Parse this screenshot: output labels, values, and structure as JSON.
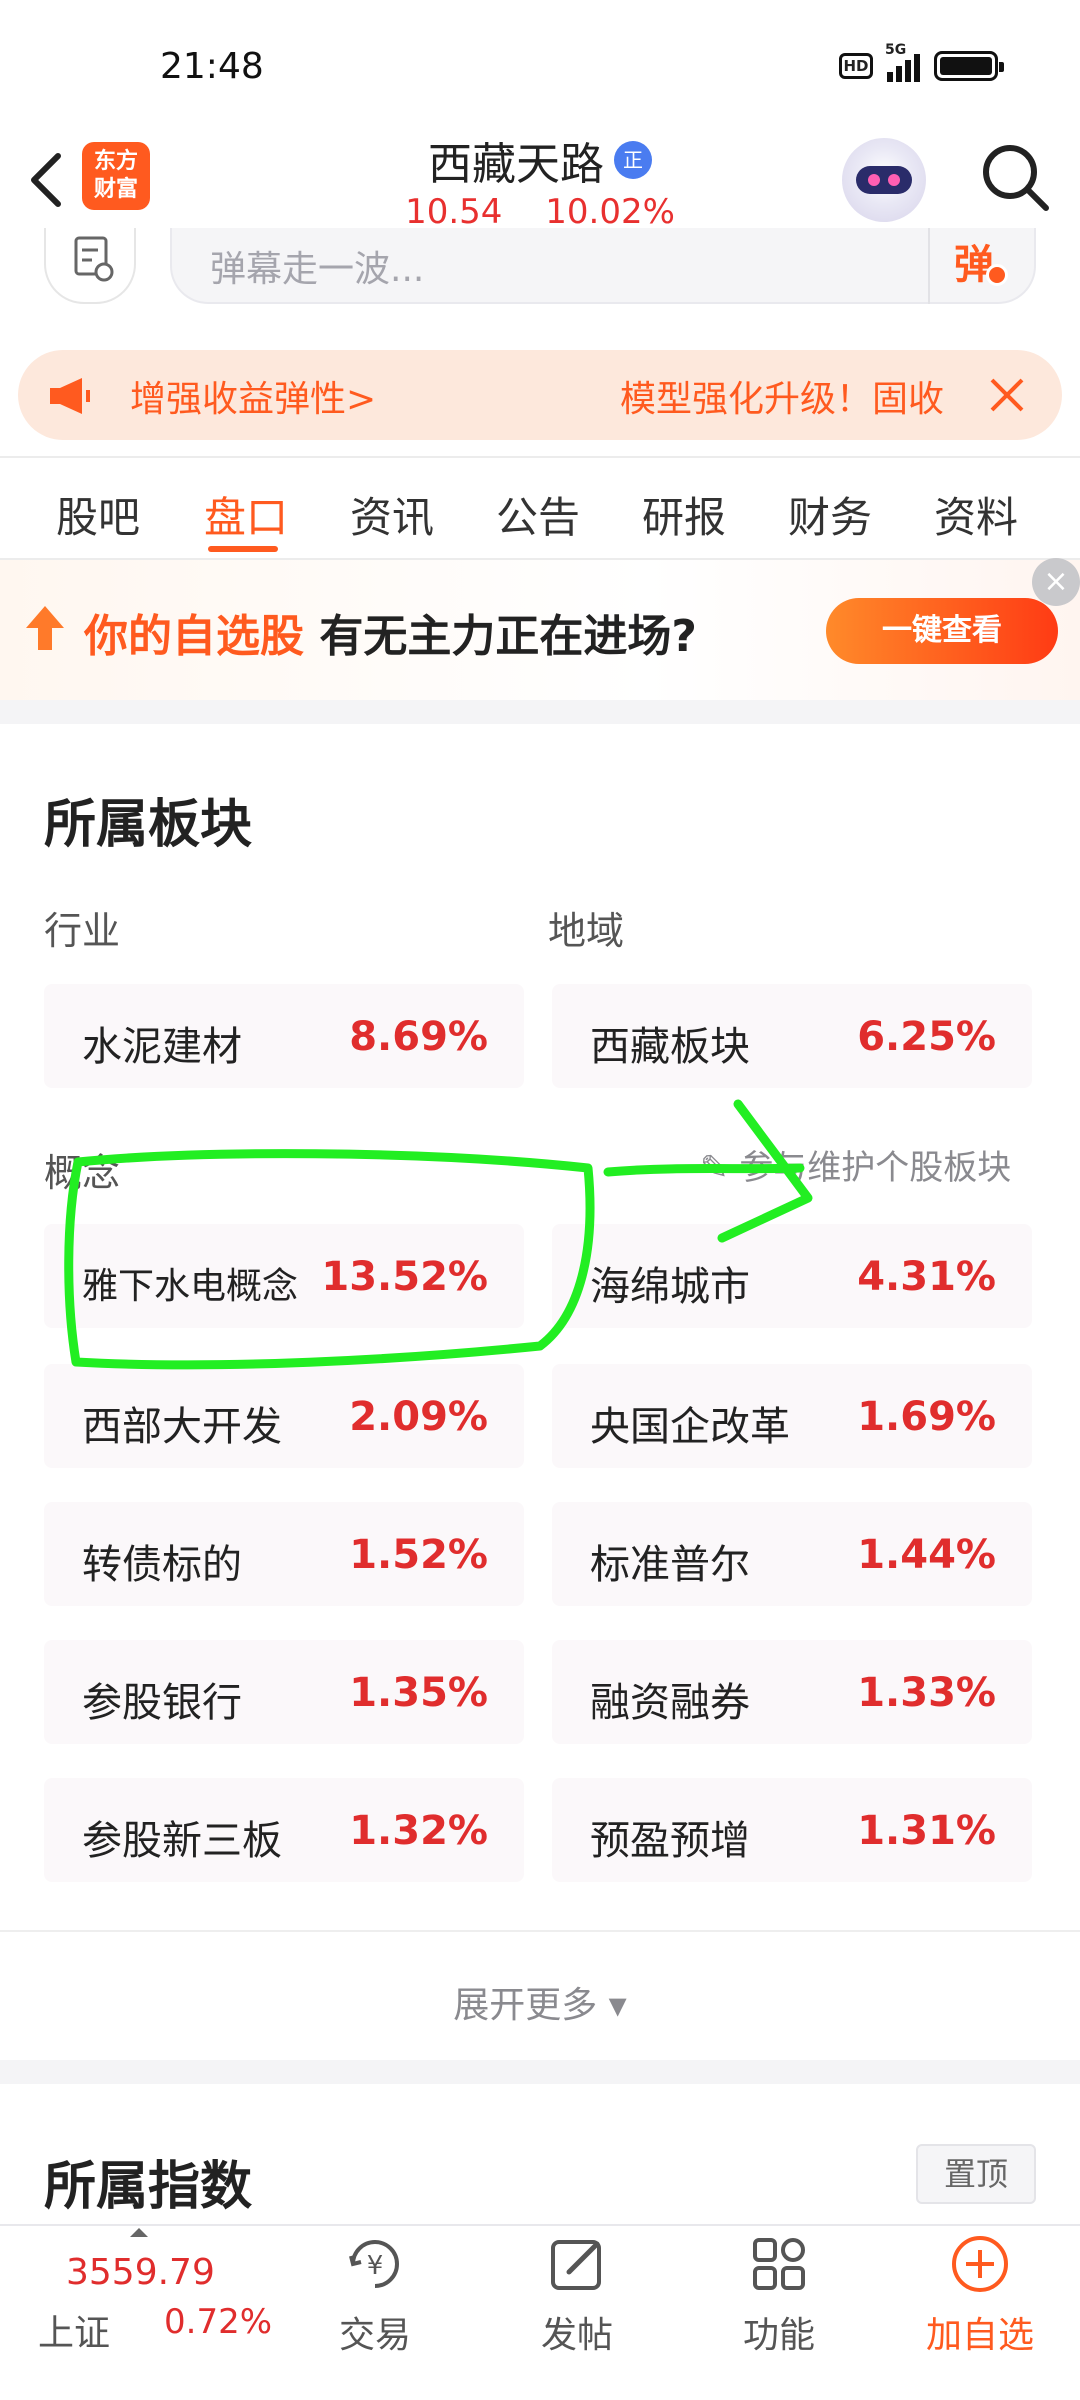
{
  "status_bar": {
    "time": "21:48",
    "network": "5G",
    "hd": "HD"
  },
  "header": {
    "logo_text_top": "东方",
    "logo_text_bottom": "财富",
    "stock_name": "西藏天路",
    "rz_badge": "正",
    "price": "10.54",
    "change_pct": "10.02%"
  },
  "danmaku": {
    "placeholder": "弹幕走一波...",
    "button_label": "弹"
  },
  "notice": {
    "left_text": "增强收益弹性>",
    "right_text": "模型强化升级！固收",
    "close_icon": "close-icon"
  },
  "tabs": [
    {
      "label": "股吧",
      "active": false
    },
    {
      "label": "盘口",
      "active": true
    },
    {
      "label": "资讯",
      "active": false
    },
    {
      "label": "公告",
      "active": false
    },
    {
      "label": "研报",
      "active": false
    },
    {
      "label": "财务",
      "active": false
    },
    {
      "label": "资料",
      "active": false
    }
  ],
  "promo": {
    "highlight": "你的自选股",
    "text": "有无主力正在进场?",
    "button_label": "一键查看"
  },
  "sectors": {
    "title": "所属板块",
    "industry_label": "行业",
    "region_label": "地域",
    "concept_label": "概念",
    "maintain_label": "参与维护个股板块",
    "industry": {
      "name": "水泥建材",
      "pct": "8.69%"
    },
    "region": {
      "name": "西藏板块",
      "pct": "6.25%"
    },
    "concepts": [
      {
        "name": "雅下水电概念",
        "pct": "13.52%"
      },
      {
        "name": "海绵城市",
        "pct": "4.31%"
      },
      {
        "name": "西部大开发",
        "pct": "2.09%"
      },
      {
        "name": "央国企改革",
        "pct": "1.69%"
      },
      {
        "name": "转债标的",
        "pct": "1.52%"
      },
      {
        "name": "标准普尔",
        "pct": "1.44%"
      },
      {
        "name": "参股银行",
        "pct": "1.35%"
      },
      {
        "name": "融资融券",
        "pct": "1.33%"
      },
      {
        "name": "参股新三板",
        "pct": "1.32%"
      },
      {
        "name": "预盈预增",
        "pct": "1.31%"
      }
    ],
    "expand_label": "展开更多 ▾"
  },
  "indices": {
    "title": "所属指数",
    "pin_label": "置顶"
  },
  "bottom_bar": {
    "index_value": "3559.79",
    "index_name": "上证",
    "index_pct": "0.72%",
    "items": [
      {
        "label": "交易",
        "icon": "yen-icon"
      },
      {
        "label": "发帖",
        "icon": "edit-icon"
      },
      {
        "label": "功能",
        "icon": "grid-icon"
      },
      {
        "label": "加自选",
        "icon": "add-circle-icon"
      }
    ]
  },
  "colors": {
    "accent": "#ff5a1f",
    "up_red": "#e02d2d",
    "annotation_green": "#22ee22"
  }
}
